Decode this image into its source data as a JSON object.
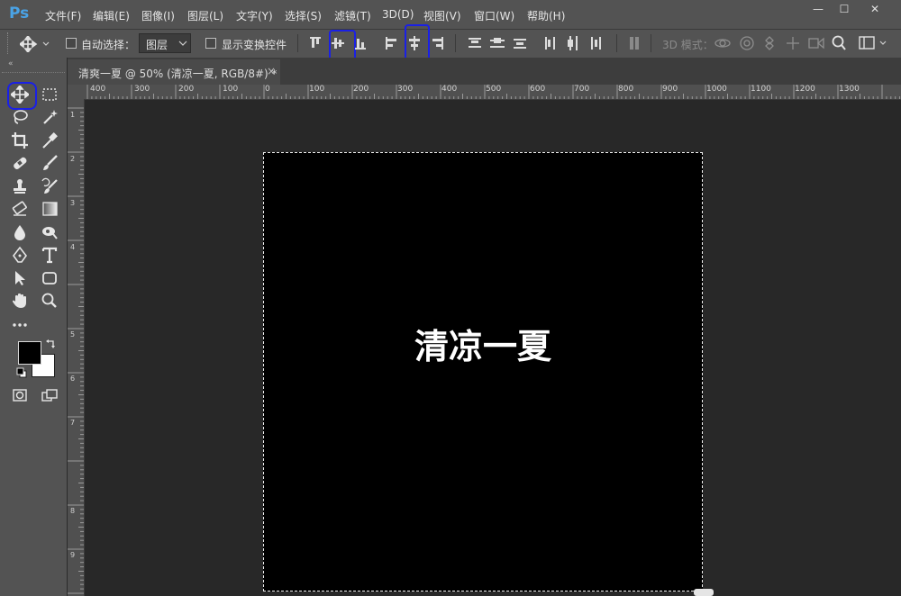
{
  "app": {
    "logo": "Ps"
  },
  "menu": [
    "文件(F)",
    "编辑(E)",
    "图像(I)",
    "图层(L)",
    "文字(Y)",
    "选择(S)",
    "滤镜(T)",
    "3D(D)",
    "视图(V)",
    "窗口(W)",
    "帮助(H)"
  ],
  "window_controls": {
    "minimize": "—",
    "maximize": "☐",
    "close": "✕"
  },
  "options": {
    "auto_select_label": "自动选择：",
    "auto_select_value": "图层",
    "show_transform_label": "显示变换控件",
    "mode_3d_label": "3D 模式："
  },
  "document": {
    "tab_title": "清爽一夏 @ 50% (清凉一夏, RGB/8#) *",
    "close_glyph": "×",
    "canvas_text": "清凉一夏"
  },
  "rulers": {
    "horizontal": [
      "400",
      "300",
      "200",
      "100",
      "0",
      "100",
      "200",
      "300",
      "400",
      "500",
      "600",
      "700",
      "800",
      "900",
      "1000",
      "1100",
      "1200",
      "1300"
    ],
    "vertical": [
      "1",
      "2",
      "3",
      "4",
      "5",
      "6",
      "7",
      "8",
      "9"
    ]
  },
  "colors": {
    "chrome": "#535353",
    "workspace": "#282828",
    "canvas": "#000000",
    "annotation_highlight": "#1a20e6",
    "logo": "#4aa3e6"
  },
  "annotations": [
    "move-tool",
    "align-vertical-centers",
    "align-horizontal-centers"
  ]
}
